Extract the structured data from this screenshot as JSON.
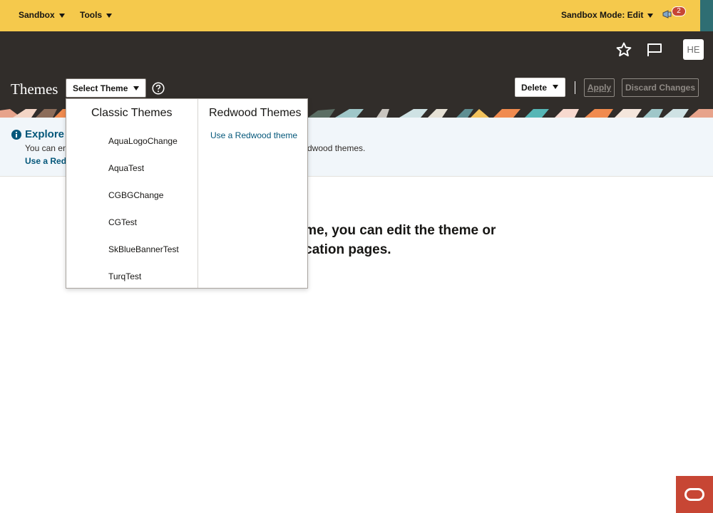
{
  "sandbox_bar": {
    "sandbox_label": "Sandbox",
    "tools_label": "Tools",
    "mode_label": "Sandbox Mode: Edit",
    "notification_count": "2",
    "notification_icon": "megaphone-icon"
  },
  "header": {
    "favorite_icon": "star-icon",
    "flag_icon": "flag-icon",
    "avatar_initials": "HE",
    "page_title": "Themes",
    "select_theme_label": "Select Theme",
    "help_icon": "help-icon",
    "delete_label": "Delete",
    "apply_label": "Apply",
    "discard_label": "Discard Changes"
  },
  "info_banner": {
    "title": "Explore",
    "text_visible_start": "You can en",
    "text_visible_end": "dwood themes.",
    "link_visible": "Use a Red"
  },
  "main": {
    "message_line1": "heme, you can edit the theme or",
    "message_line2": "plication pages."
  },
  "theme_dropdown": {
    "classic_heading": "Classic Themes",
    "classic_items": [
      "AquaLogoChange",
      "AquaTest",
      "CGBGChange",
      "CGTest",
      "SkBlueBannerTest",
      "TurqTest"
    ],
    "redwood_heading": "Redwood Themes",
    "redwood_link": "Use a Redwood theme"
  },
  "colors": {
    "sandbox_bar": "#f5c94c",
    "header_bg": "#312d2a",
    "accent_link": "#04577a",
    "badge": "#c74634",
    "oracle_button": "#c74634",
    "info_bg": "#f1f6fa"
  }
}
